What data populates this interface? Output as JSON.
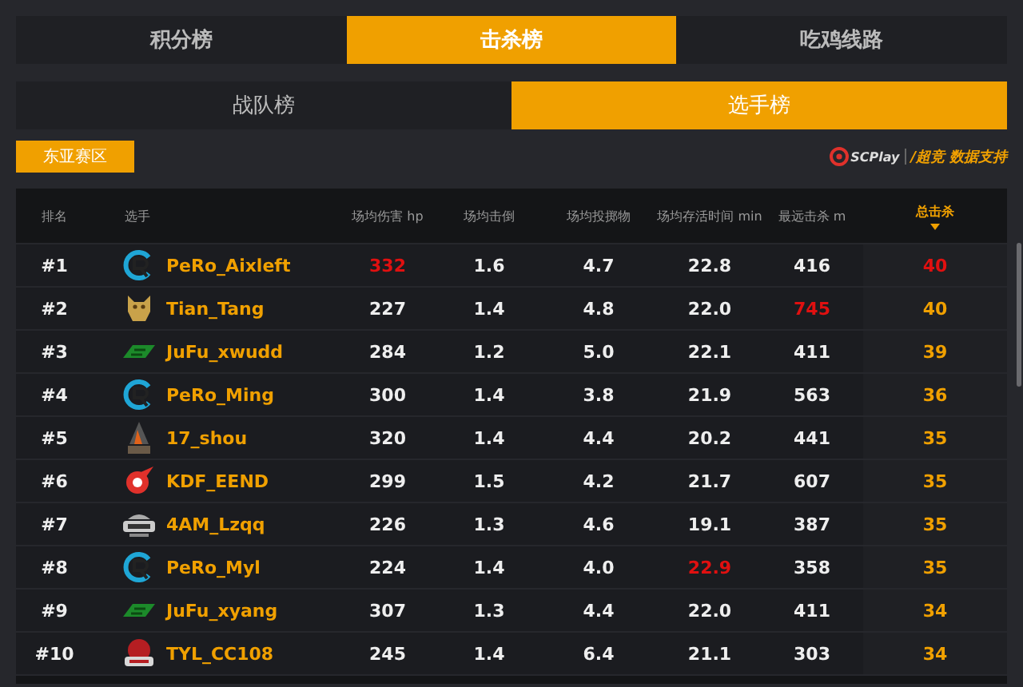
{
  "main_tabs": [
    {
      "label": "积分榜",
      "selected": false
    },
    {
      "label": "击杀榜",
      "selected": true
    },
    {
      "label": "吃鸡线路",
      "selected": false
    }
  ],
  "sub_tabs": [
    {
      "label": "战队榜",
      "selected": false
    },
    {
      "label": "选手榜",
      "selected": true
    }
  ],
  "region_button": {
    "label": "东亚赛区"
  },
  "sponsor": {
    "logos": [
      {
        "kind": "scplay",
        "label": "SCPlay"
      },
      {
        "kind": "chaojing",
        "label": "/超竞"
      }
    ],
    "label": "数据支持"
  },
  "table": {
    "columns": [
      {
        "label": "排名",
        "sorted": false
      },
      {
        "label": "选手",
        "sorted": false
      },
      {
        "label": "场均伤害 hp",
        "sorted": false
      },
      {
        "label": "场均击倒",
        "sorted": false
      },
      {
        "label": "场均投掷物",
        "sorted": false
      },
      {
        "label": "场均存活时间 min",
        "sorted": false
      },
      {
        "label": "最远击杀 m",
        "sorted": false
      },
      {
        "label": "总击杀",
        "sorted": true
      }
    ],
    "rows": [
      {
        "rank": "#1",
        "logo": {
          "kind": "ring"
        },
        "player": "PeRo_Aixleft",
        "stats": [
          {
            "value": "332",
            "highlight": true
          },
          {
            "value": "1.6",
            "highlight": false
          },
          {
            "value": "4.7",
            "highlight": false
          },
          {
            "value": "22.8",
            "highlight": false
          },
          {
            "value": "416",
            "highlight": false
          },
          {
            "value": "40",
            "highlight": true
          }
        ]
      },
      {
        "rank": "#2",
        "logo": {
          "kind": "mascot"
        },
        "player": "Tian_Tang",
        "stats": [
          {
            "value": "227",
            "highlight": false
          },
          {
            "value": "1.4",
            "highlight": false
          },
          {
            "value": "4.8",
            "highlight": false
          },
          {
            "value": "22.0",
            "highlight": false
          },
          {
            "value": "745",
            "highlight": true
          },
          {
            "value": "40",
            "highlight": false
          }
        ]
      },
      {
        "rank": "#3",
        "logo": {
          "kind": "stripe"
        },
        "player": "JuFu_xwudd",
        "stats": [
          {
            "value": "284",
            "highlight": false
          },
          {
            "value": "1.2",
            "highlight": false
          },
          {
            "value": "5.0",
            "highlight": false
          },
          {
            "value": "22.1",
            "highlight": false
          },
          {
            "value": "411",
            "highlight": false
          },
          {
            "value": "39",
            "highlight": false
          }
        ]
      },
      {
        "rank": "#4",
        "logo": {
          "kind": "ring"
        },
        "player": "PeRo_Ming",
        "stats": [
          {
            "value": "300",
            "highlight": false
          },
          {
            "value": "1.4",
            "highlight": false
          },
          {
            "value": "3.8",
            "highlight": false
          },
          {
            "value": "21.9",
            "highlight": false
          },
          {
            "value": "563",
            "highlight": false
          },
          {
            "value": "36",
            "highlight": false
          }
        ]
      },
      {
        "rank": "#5",
        "logo": {
          "kind": "tower"
        },
        "player": "17_shou",
        "stats": [
          {
            "value": "320",
            "highlight": false
          },
          {
            "value": "1.4",
            "highlight": false
          },
          {
            "value": "4.4",
            "highlight": false
          },
          {
            "value": "20.2",
            "highlight": false
          },
          {
            "value": "441",
            "highlight": false
          },
          {
            "value": "35",
            "highlight": false
          }
        ]
      },
      {
        "rank": "#6",
        "logo": {
          "kind": "wing"
        },
        "player": "KDF_EEND",
        "stats": [
          {
            "value": "299",
            "highlight": false
          },
          {
            "value": "1.5",
            "highlight": false
          },
          {
            "value": "4.2",
            "highlight": false
          },
          {
            "value": "21.7",
            "highlight": false
          },
          {
            "value": "607",
            "highlight": false
          },
          {
            "value": "35",
            "highlight": false
          }
        ]
      },
      {
        "rank": "#7",
        "logo": {
          "kind": "badge"
        },
        "player": "4AM_Lzqq",
        "stats": [
          {
            "value": "226",
            "highlight": false
          },
          {
            "value": "1.3",
            "highlight": false
          },
          {
            "value": "4.6",
            "highlight": false
          },
          {
            "value": "19.1",
            "highlight": false
          },
          {
            "value": "387",
            "highlight": false
          },
          {
            "value": "35",
            "highlight": false
          }
        ]
      },
      {
        "rank": "#8",
        "logo": {
          "kind": "ring"
        },
        "player": "PeRo_Myl",
        "stats": [
          {
            "value": "224",
            "highlight": false
          },
          {
            "value": "1.4",
            "highlight": false
          },
          {
            "value": "4.0",
            "highlight": false
          },
          {
            "value": "22.9",
            "highlight": true
          },
          {
            "value": "358",
            "highlight": false
          },
          {
            "value": "35",
            "highlight": false
          }
        ]
      },
      {
        "rank": "#9",
        "logo": {
          "kind": "stripe"
        },
        "player": "JuFu_xyang",
        "stats": [
          {
            "value": "307",
            "highlight": false
          },
          {
            "value": "1.3",
            "highlight": false
          },
          {
            "value": "4.4",
            "highlight": false
          },
          {
            "value": "22.0",
            "highlight": false
          },
          {
            "value": "411",
            "highlight": false
          },
          {
            "value": "34",
            "highlight": false
          }
        ]
      },
      {
        "rank": "#10",
        "logo": {
          "kind": "shield"
        },
        "player": "TYL_CC108",
        "stats": [
          {
            "value": "245",
            "highlight": false
          },
          {
            "value": "1.4",
            "highlight": false
          },
          {
            "value": "6.4",
            "highlight": false
          },
          {
            "value": "21.1",
            "highlight": false
          },
          {
            "value": "303",
            "highlight": false
          },
          {
            "value": "34",
            "highlight": false
          }
        ]
      }
    ]
  }
}
